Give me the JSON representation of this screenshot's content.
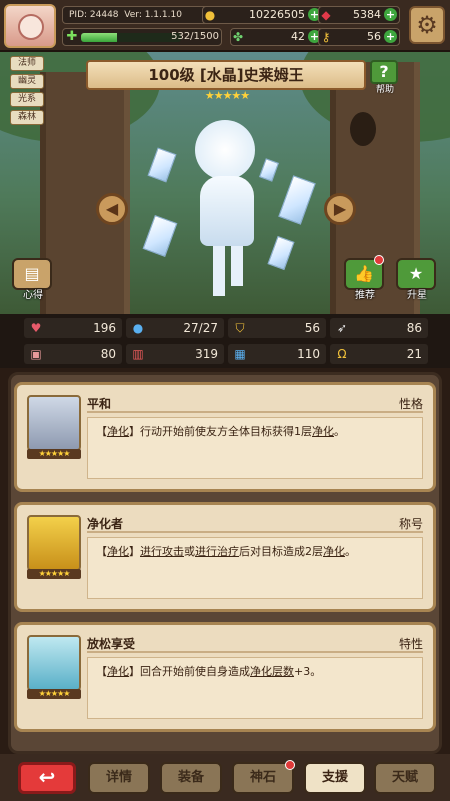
{
  "header": {
    "pid": "PID: 24448",
    "version": "Ver: 1.1.1.10",
    "exp_text": "532/1500",
    "exp_fraction": 0.355,
    "gold": "10226505",
    "gems": "5384",
    "clover": "42",
    "key": "56"
  },
  "hero": {
    "tags": [
      "法师",
      "幽灵",
      "光系",
      "森林"
    ],
    "title": "100级 [水晶]史莱姆王",
    "stars": "★★★★★",
    "help_label": "帮助",
    "help_icon": "?",
    "side_left_label": "心得",
    "side_recommend_label": "推荐",
    "side_upgrade_label": "升星"
  },
  "stats": {
    "hp": "196",
    "mana": "27/27",
    "shield": "56",
    "speed": "86",
    "attack": "80",
    "magic": "319",
    "defense": "110",
    "crit": "21"
  },
  "cards": [
    {
      "name": "平和",
      "kind": "性格",
      "desc_parts": [
        "【",
        "净化",
        "】行动开始前使友方全体目标获得1层",
        "净化",
        "。"
      ],
      "stars": "★★★★★"
    },
    {
      "name": "净化者",
      "kind": "称号",
      "desc_parts": [
        "【",
        "净化",
        "】",
        "进行攻击",
        "或",
        "进行治疗",
        "后对目标造成2层",
        "净化",
        "。"
      ],
      "stars": "★★★★★"
    },
    {
      "name": "放松享受",
      "kind": "特性",
      "desc_parts": [
        "【",
        "净化",
        "】回合开始前使自身造成",
        "净化层数",
        "+3。"
      ],
      "stars": "★★★★★"
    }
  ],
  "bottom_tabs": {
    "back_icon": "↩",
    "details": "详情",
    "equip": "装备",
    "stone": "神石",
    "support": "支援",
    "talent": "天赋"
  },
  "colors": {
    "accent_green": "#3ea63e",
    "back_red": "#e43a3a",
    "card_bg": "#ecdcbf",
    "star_gold": "#ffd23a"
  }
}
